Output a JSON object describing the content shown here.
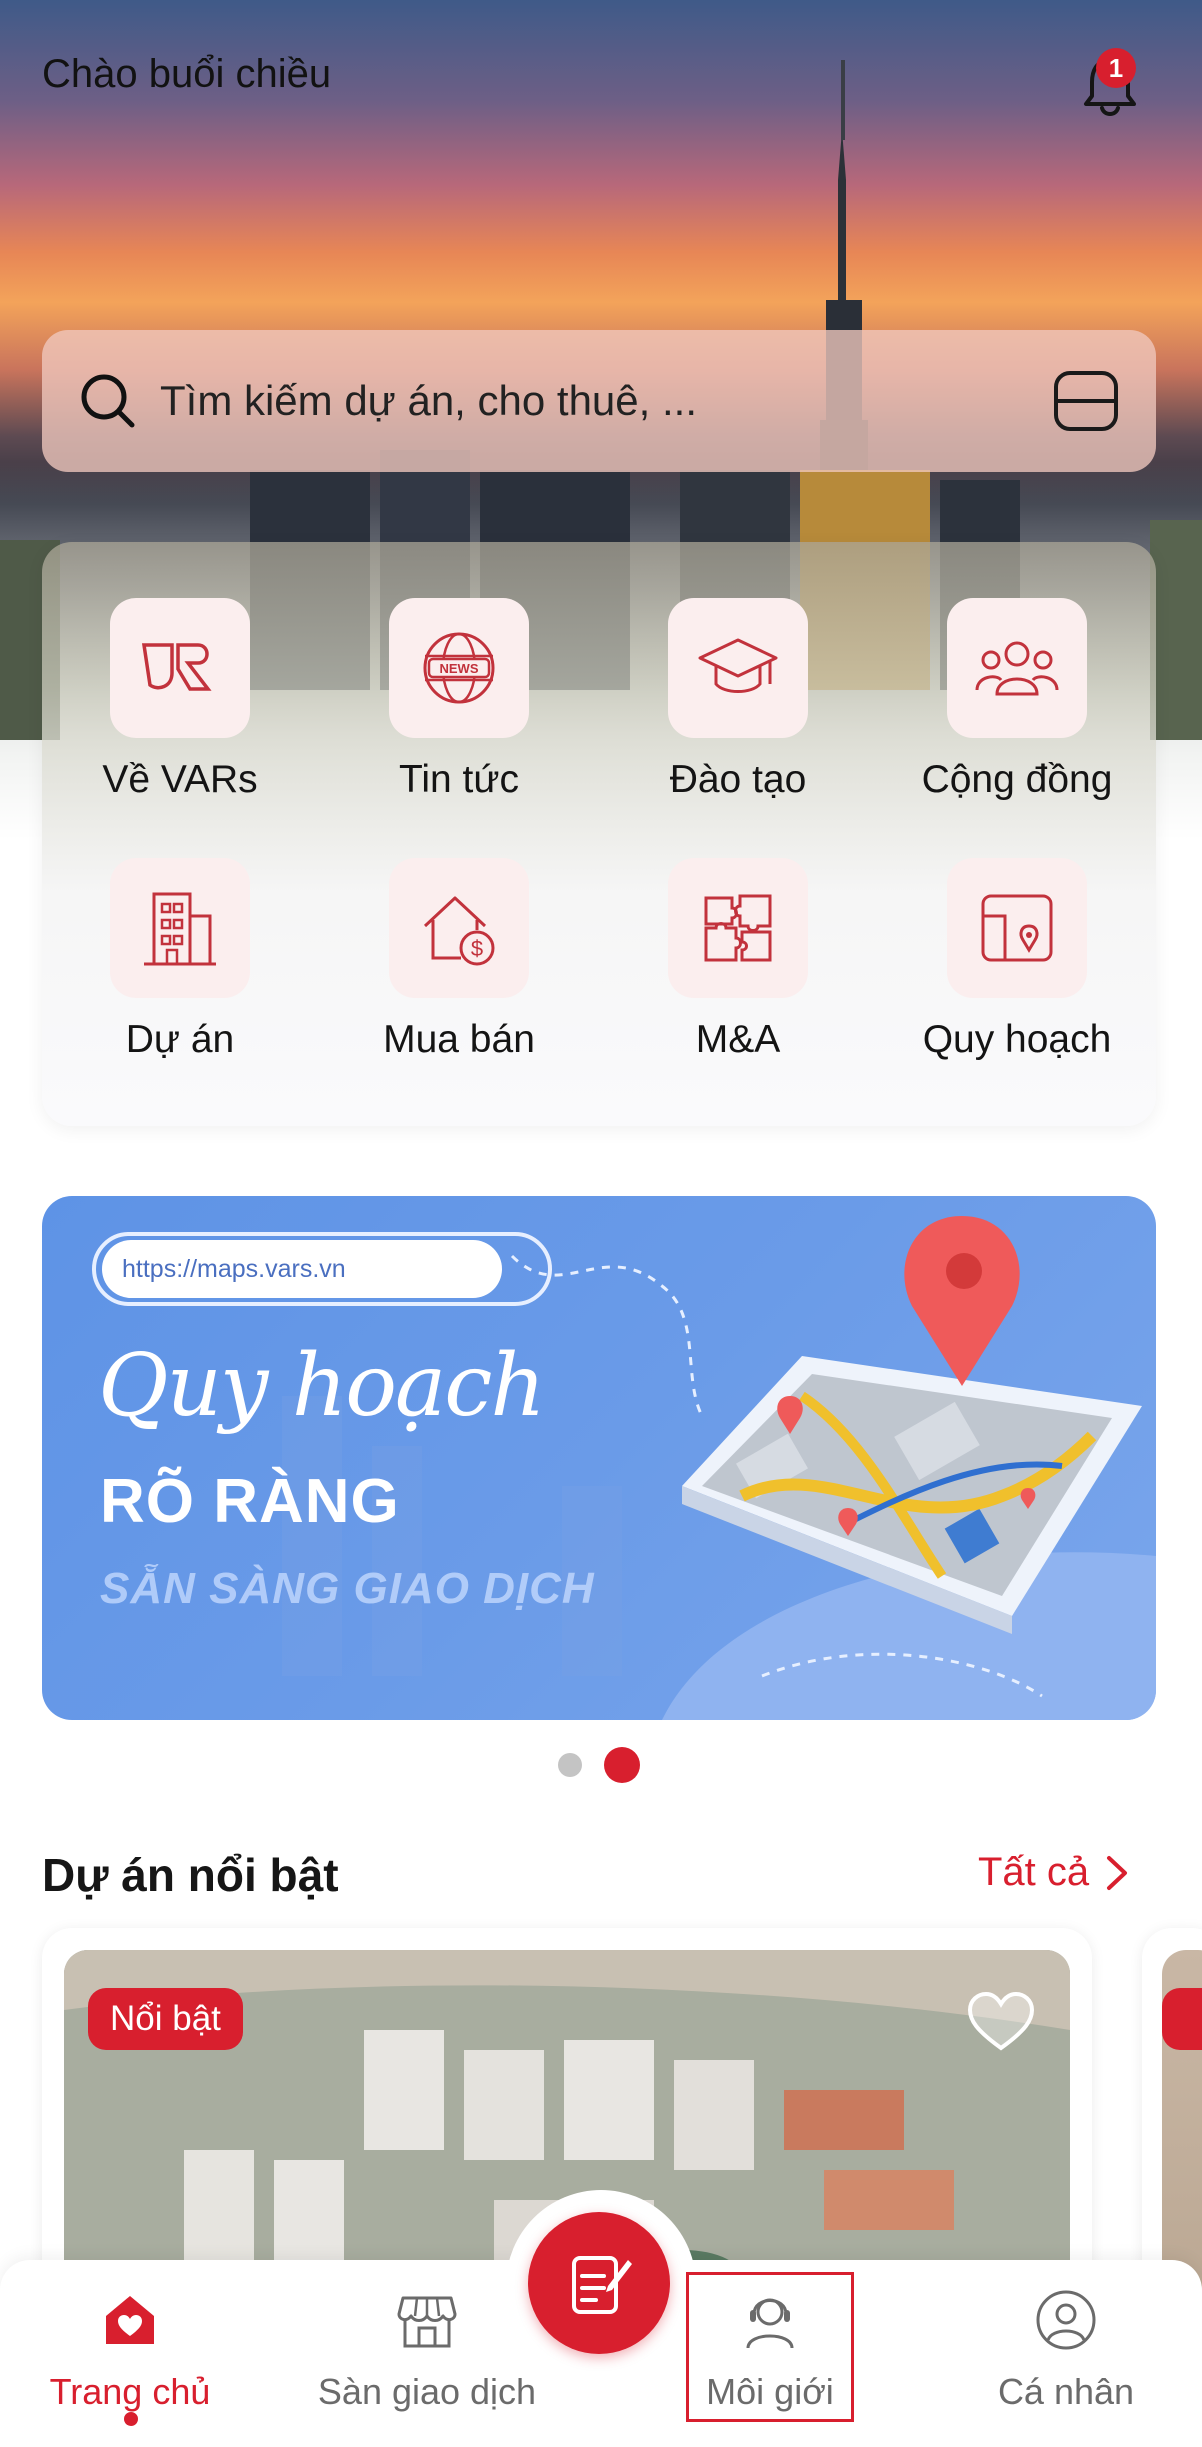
{
  "header": {
    "greeting": "Chào buổi chiều",
    "notification_count": "1"
  },
  "search": {
    "placeholder": "Tìm kiếm dự án, cho thuê, ..."
  },
  "menu": {
    "items": [
      {
        "label": "Về VARs",
        "icon": "vars-logo-icon"
      },
      {
        "label": "Tin tức",
        "icon": "news-globe-icon"
      },
      {
        "label": "Đào tạo",
        "icon": "graduation-cap-icon"
      },
      {
        "label": "Cộng đồng",
        "icon": "community-icon"
      },
      {
        "label": "Dự án",
        "icon": "building-icon"
      },
      {
        "label": "Mua bán",
        "icon": "house-dollar-icon"
      },
      {
        "label": "M&A",
        "icon": "puzzle-icon"
      },
      {
        "label": "Quy hoạch",
        "icon": "map-pin-icon"
      }
    ]
  },
  "banner": {
    "url": "https://maps.vars.vn",
    "script_title": "Quy hoạch",
    "headline": "RÕ RÀNG",
    "subline": "SẴN SÀNG GIAO DỊCH",
    "active_slide": 2,
    "total_slides": 2
  },
  "featured": {
    "title": "Dự án nổi bật",
    "see_all": "Tất cả",
    "card": {
      "tag": "Nổi bật"
    }
  },
  "bottom_nav": {
    "items": [
      {
        "label": "Trang chủ",
        "active": true
      },
      {
        "label": "Sàn giao dịch",
        "active": false
      },
      {
        "label": "Môi giới",
        "active": false
      },
      {
        "label": "Cá nhân",
        "active": false
      }
    ]
  },
  "colors": {
    "brand_red": "#d81f2e",
    "tile_bg": "#fbeeee",
    "banner_blue": "#6a9be8"
  }
}
